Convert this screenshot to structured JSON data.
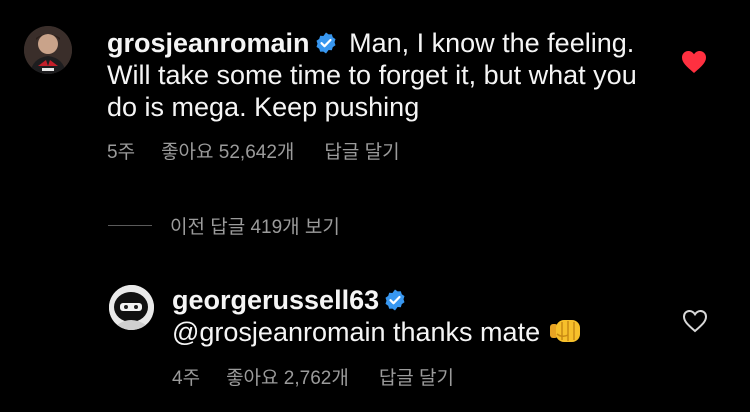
{
  "comment1": {
    "username": "grosjeanromain",
    "text": "Man, I know the feeling. Will take some time to forget it, but what you do is mega. Keep pushing",
    "time": "5주",
    "likes": "좋아요 52,642개",
    "reply_label": "답글 달기",
    "liked": true,
    "like_color": "#ff3040"
  },
  "view_replies": {
    "label": "이전 답글 419개 보기"
  },
  "comment2": {
    "username": "georgerussell63",
    "text": "@grosjeanromain thanks mate",
    "emoji": "oncoming-fist",
    "time": "4주",
    "likes": "좋아요 2,762개",
    "reply_label": "답글 달기",
    "liked": false
  },
  "colors": {
    "verified": "#3897f0",
    "muted_text": "#9b9b9b",
    "background": "#000000"
  }
}
